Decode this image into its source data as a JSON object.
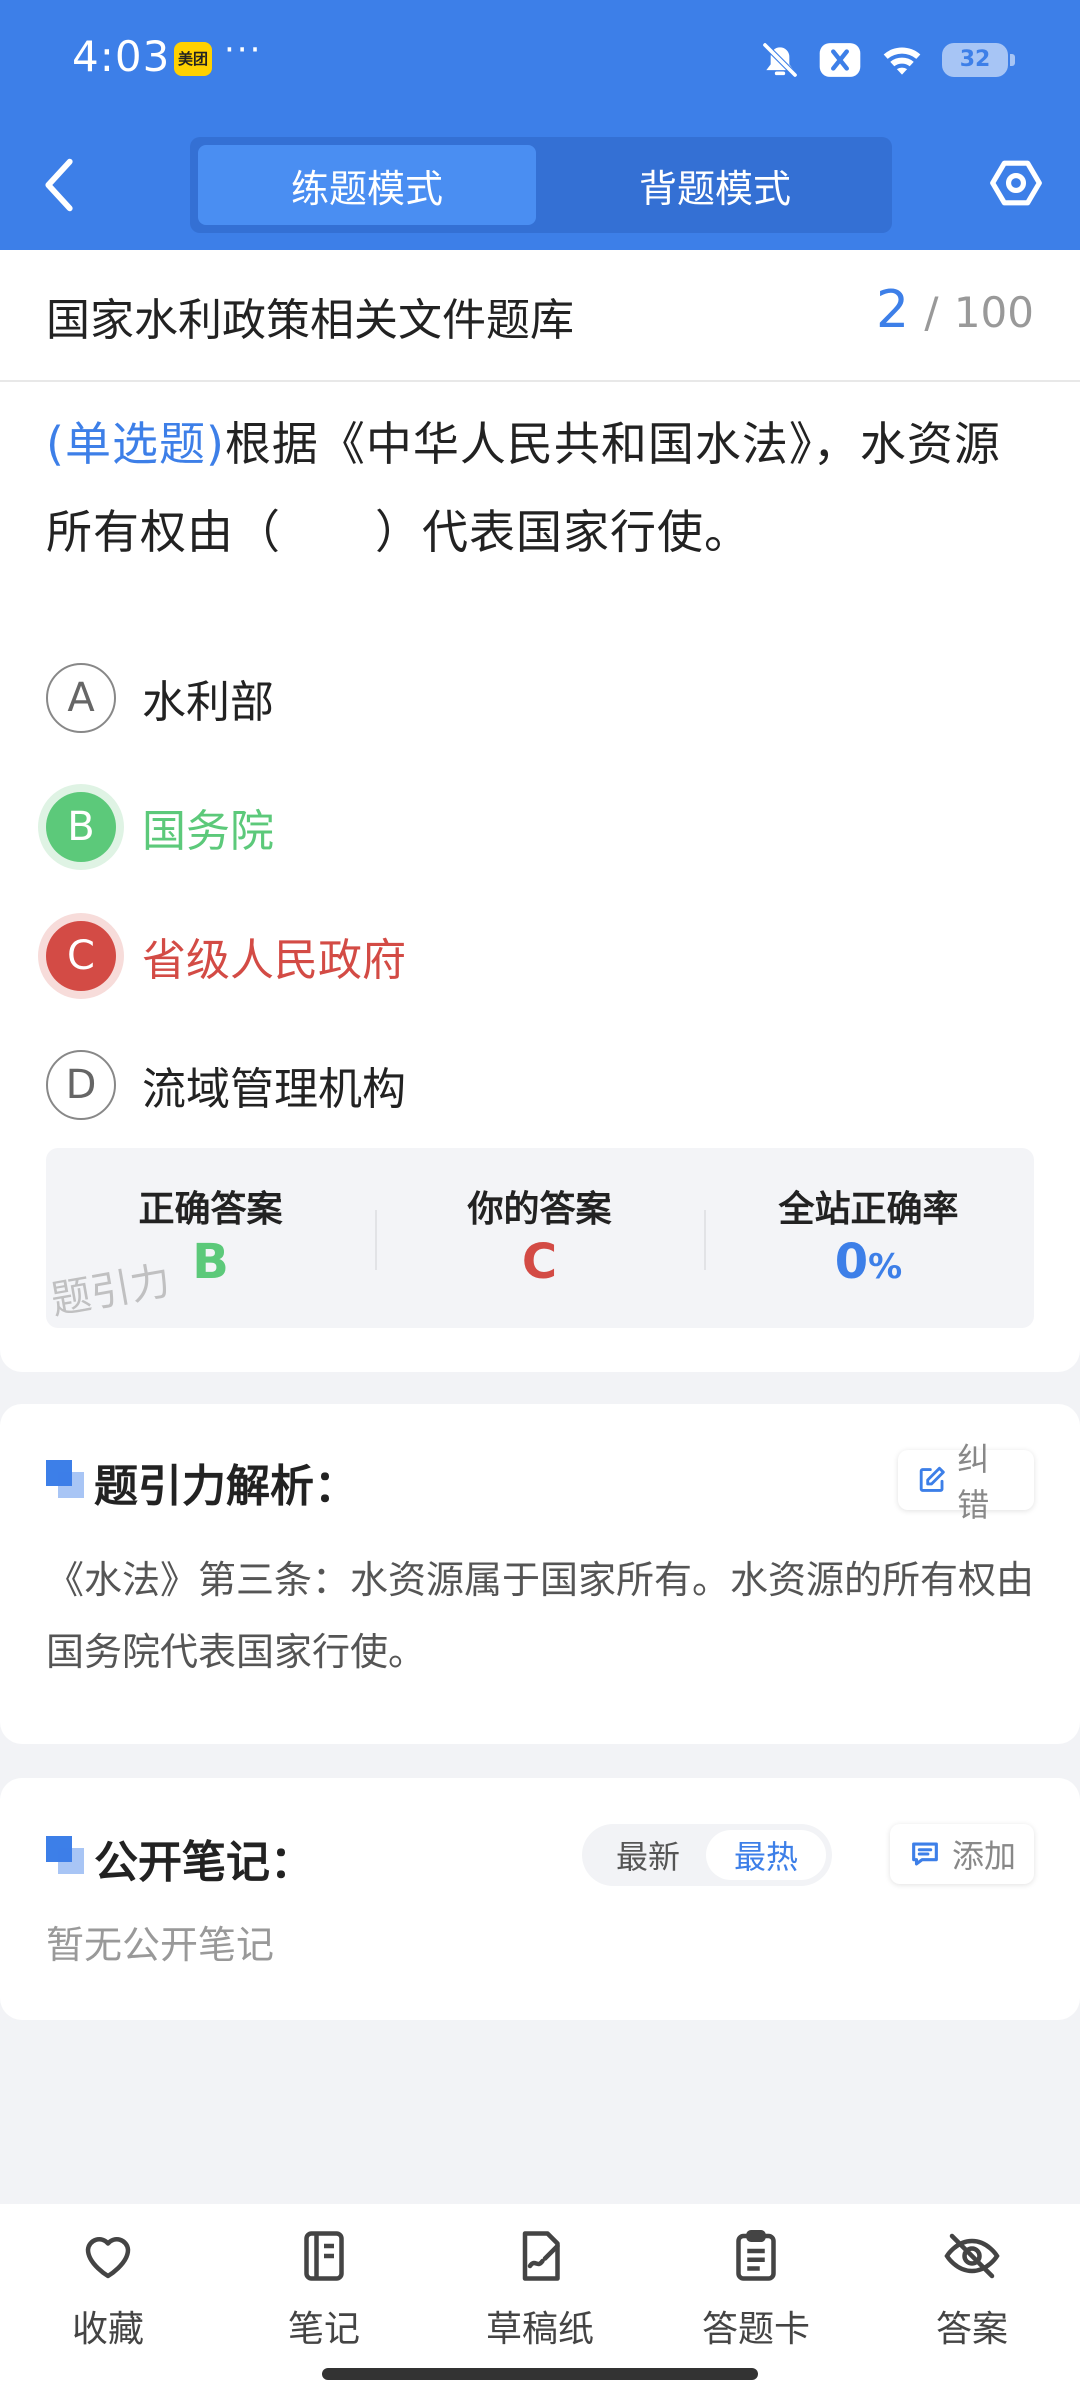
{
  "status_bar": {
    "time": "4:03",
    "app_badge": "美团",
    "more": "···",
    "battery": "32",
    "icons": [
      "bell-off-icon",
      "close-badge-icon",
      "wifi-icon",
      "battery-icon"
    ]
  },
  "header": {
    "back_icon": "chevron-left-icon",
    "tabs": [
      {
        "label": "练题模式",
        "active": true
      },
      {
        "label": "背题模式",
        "active": false
      }
    ],
    "settings_icon": "hexagon-settings-icon"
  },
  "question_bank": {
    "title": "国家水利政策相关文件题库",
    "current": "2",
    "separator": "/",
    "total": "100"
  },
  "question": {
    "type_label": "(单选题)",
    "text": "根据《中华人民共和国水法》，水资源所有权由（　　）代表国家行使。",
    "options": [
      {
        "letter": "A",
        "text": "水利部",
        "state": "normal"
      },
      {
        "letter": "B",
        "text": "国务院",
        "state": "correct"
      },
      {
        "letter": "C",
        "text": "省级人民政府",
        "state": "wrong"
      },
      {
        "letter": "D",
        "text": "流域管理机构",
        "state": "normal"
      }
    ]
  },
  "answer_summary": {
    "correct_label": "正确答案",
    "correct_value": "B",
    "yours_label": "你的答案",
    "yours_value": "C",
    "rate_label": "全站正确率",
    "rate_value": "0",
    "rate_unit": "%",
    "watermark": "题引力"
  },
  "analysis": {
    "title": "题引力解析：",
    "report_label": "纠错",
    "text": "《水法》第三条：水资源属于国家所有。水资源的所有权由国务院代表国家行使。"
  },
  "notes": {
    "title": "公开笔记：",
    "sort_latest": "最新",
    "sort_hot": "最热",
    "add_label": "添加",
    "empty_text": "暂无公开笔记"
  },
  "bottom_nav": [
    {
      "label": "收藏",
      "icon": "heart-icon"
    },
    {
      "label": "笔记",
      "icon": "notebook-icon"
    },
    {
      "label": "草稿纸",
      "icon": "draft-paper-icon"
    },
    {
      "label": "答题卡",
      "icon": "answer-card-icon"
    },
    {
      "label": "答案",
      "icon": "eye-off-icon"
    }
  ],
  "colors": {
    "primary": "#3d7fe8",
    "correct": "#5cc97a",
    "wrong": "#d34b45"
  }
}
